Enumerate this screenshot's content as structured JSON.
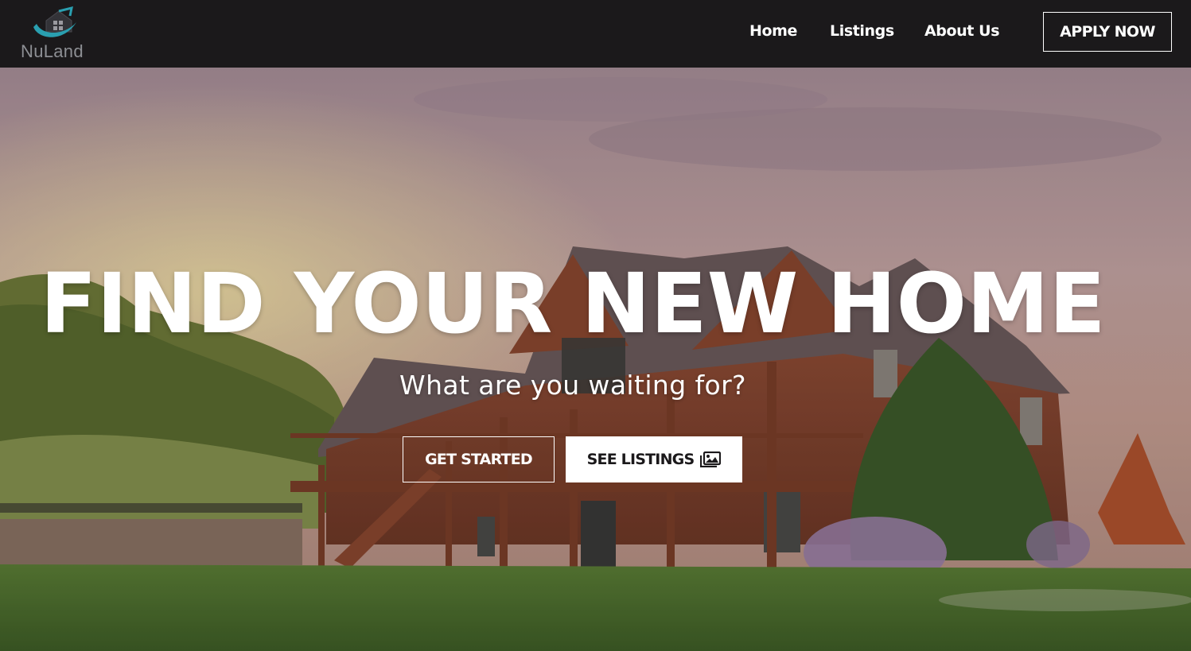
{
  "brand": {
    "name": "NuLand",
    "logo_icon": "house-swoosh-logo",
    "accent_color": "#2a9fb0"
  },
  "nav": {
    "items": [
      {
        "label": "Home"
      },
      {
        "label": "Listings"
      },
      {
        "label": "About Us"
      }
    ],
    "cta_label": "APPLY NOW"
  },
  "hero": {
    "title": "FIND YOUR NEW HOME",
    "subtitle": "What are you waiting for?",
    "primary_button": "GET STARTED",
    "secondary_button": "SEE LISTINGS",
    "secondary_button_icon": "images-icon"
  },
  "colors": {
    "navbar_bg": "#1b191b",
    "text_light": "#ffffff"
  }
}
